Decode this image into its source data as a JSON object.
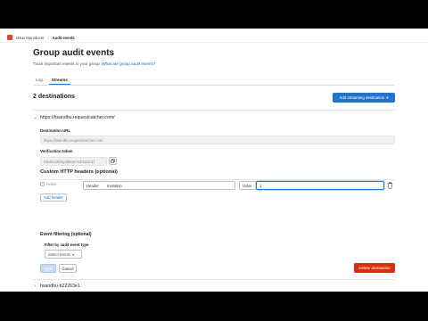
{
  "breadcrumb": {
    "group": "Issue reproducer",
    "separator": "/",
    "current": "Audit events"
  },
  "page": {
    "title": "Group audit events",
    "description": "Track important events in your group.",
    "help_link": "What are group audit events?"
  },
  "tabs": [
    {
      "label": "Log",
      "active": false
    },
    {
      "label": "Streams",
      "active": true
    }
  ],
  "destinations": {
    "count_label": "2 destinations",
    "add_button_label": "Add streaming destination",
    "add_button_icon": "chevron-down-icon",
    "items": [
      {
        "name": "https://hsandhu.requestcatcher.com/",
        "expanded": true,
        "destination_url_label": "Destination URL",
        "destination_url_value": "https://hsandhu.requestcatcher.com",
        "verification_token_label": "Verification token",
        "verification_token_value": "Kkx8oo2E5yaf6s3eYoF22Gn1f",
        "headers_title": "Custom HTTP headers (optional)",
        "header_row": {
          "active_label": "Active",
          "header_prefix": "Header",
          "header_value": "Invitation",
          "value_prefix": "Value",
          "value_input": "1"
        },
        "add_header_label": "Add header",
        "event_filtering_title": "Event filtering (optional)",
        "filter_label": "Filter by audit event type",
        "select_placeholder": "Select events",
        "save_label": "Save",
        "cancel_label": "Cancel",
        "delete_label": "Delete destination"
      },
      {
        "name": "hsandhu-b22263e1",
        "expanded": false
      }
    ]
  },
  "colors": {
    "primary": "#1f75cb",
    "danger": "#dd2b0e",
    "link": "#1068bf"
  }
}
